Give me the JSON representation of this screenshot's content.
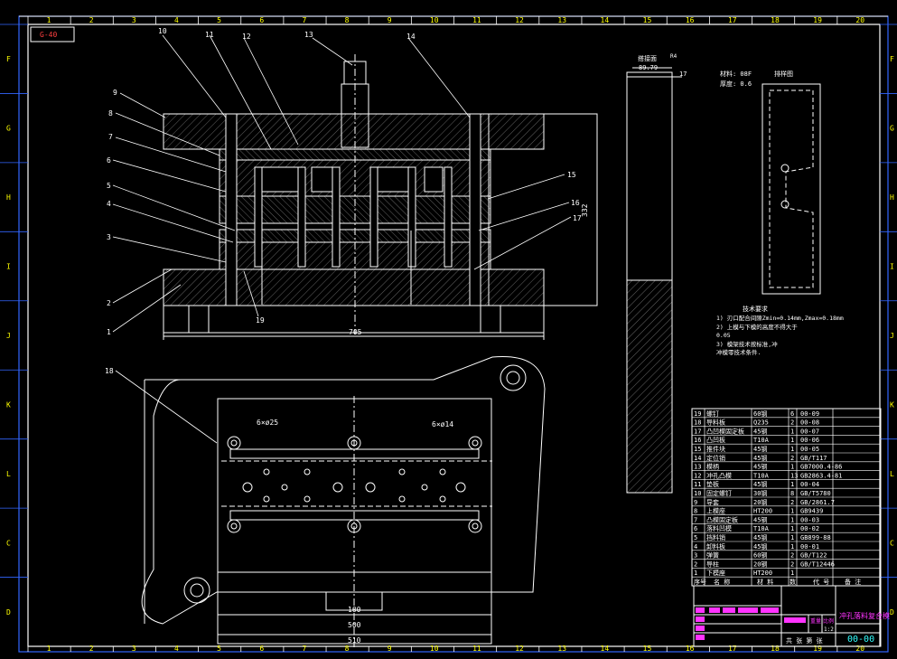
{
  "colors": {
    "background": "#000000",
    "frame": "#3366ff",
    "line": "#ffffff",
    "title_text": "#ff33ff",
    "ruler_text": "#ffff00"
  },
  "ruler": {
    "columns": [
      "1",
      "2",
      "3",
      "4",
      "5",
      "6",
      "7",
      "8",
      "9",
      "10",
      "11",
      "12",
      "13",
      "14",
      "15",
      "16",
      "17",
      "18",
      "19",
      "20"
    ],
    "rows": [
      "F",
      "G",
      "H",
      "I",
      "J",
      "K",
      "L",
      "C",
      "D"
    ]
  },
  "tag": "G-40",
  "balloons": [
    "1",
    "2",
    "3",
    "4",
    "5",
    "6",
    "7",
    "8",
    "9",
    "10",
    "11",
    "12",
    "13",
    "14",
    "15",
    "16",
    "17",
    "18",
    "19"
  ],
  "dims": {
    "width_705": "705",
    "height_332": "332",
    "holes_25": "6×ø25",
    "holes_14": "6×ø14",
    "w_100": "100",
    "w_500": "500",
    "w_510": "510"
  },
  "strip": {
    "label": "搭接面",
    "value": "89.79",
    "thick": "17",
    "radius": "R4"
  },
  "part_note": {
    "material": "材料: 08F",
    "thickness": "厚度: 0.6",
    "layout_label": "排样图"
  },
  "tech": {
    "title": "技术要求",
    "lines": [
      "1) 刃口配合间隙Zmin=0.14mm,Zmax=0.18mm",
      "2) 上模与下模的高度不得大于",
      "   0.05",
      "3) 模架技术按标准,冲",
      "冲模零技术条件."
    ]
  },
  "bom": {
    "rows": [
      [
        "19",
        "螺钉",
        "60钢",
        "6",
        "00-09"
      ],
      [
        "18",
        "导料板",
        "Q235",
        "2",
        "00-08"
      ],
      [
        "17",
        "凸凹模固定板",
        "45钢",
        "1",
        "00-07"
      ],
      [
        "16",
        "凸凹板",
        "T10A",
        "1",
        "00-06"
      ],
      [
        "15",
        "推件块",
        "45钢",
        "1",
        "00-05"
      ],
      [
        "14",
        "定位销",
        "45钢",
        "2",
        "GB/T117"
      ],
      [
        "13",
        "模柄",
        "45钢",
        "1",
        "GB7000.4-86"
      ],
      [
        "12",
        "冲孔凸模",
        "T10A",
        "13",
        "GB2863.4-81"
      ],
      [
        "11",
        "垫板",
        "45钢",
        "1",
        "00-04"
      ],
      [
        "10",
        "固定螺钉",
        "30钢",
        "8",
        "GB/T5780"
      ],
      [
        "9",
        "导套",
        "20钢",
        "2",
        "GB/2861.7"
      ],
      [
        "8",
        "上模座",
        "HT200",
        "1",
        "GB9439"
      ],
      [
        "7",
        "凸模固定板",
        "45钢",
        "1",
        "00-03"
      ],
      [
        "6",
        "落料凹模",
        "T10A",
        "1",
        "00-02"
      ],
      [
        "5",
        "挡料销",
        "45钢",
        "1",
        "GB899-88"
      ],
      [
        "4",
        "卸料板",
        "45钢",
        "1",
        "00-01"
      ],
      [
        "3",
        "弹簧",
        "60钢",
        "2",
        "GB/T122"
      ],
      [
        "2",
        "导柱",
        "20钢",
        "2",
        "GB/T12446"
      ],
      [
        "1",
        "下模座",
        "HT200",
        "1",
        ""
      ]
    ],
    "headers": [
      "序号",
      "名 称",
      "材 料",
      "数",
      "代 号",
      "备 注"
    ]
  },
  "title_block": {
    "drawing_title": "冲孔落料复合模",
    "code": "00-00",
    "scale": "1:2",
    "sheet": "共 张 第 张",
    "weight": "重量",
    "ratio": "比例"
  }
}
